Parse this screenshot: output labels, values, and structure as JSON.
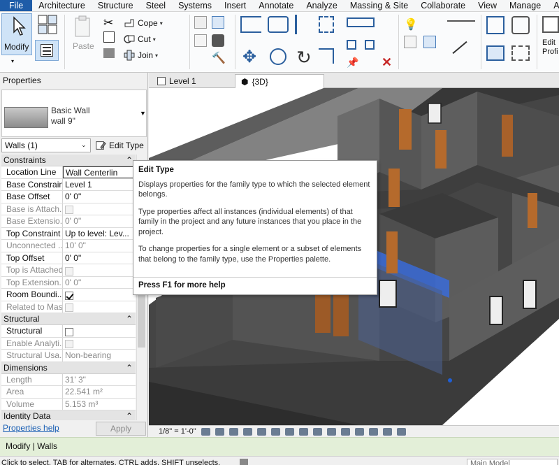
{
  "menu_tabs": [
    "File",
    "Architecture",
    "Structure",
    "Steel",
    "Systems",
    "Insert",
    "Annotate",
    "Analyze",
    "Massing & Site",
    "Collaborate",
    "View",
    "Manage",
    "Add-Ins"
  ],
  "ribbon": {
    "modify": "Modify",
    "paste": "Paste",
    "cope": "Cope",
    "cut": "Cut",
    "join": "Join",
    "edit_profile": "Edit\nProfi"
  },
  "properties": {
    "title": "Properties",
    "type_family": "Basic Wall",
    "type_name": "wall 9\"",
    "filter": "Walls (1)",
    "edit_type": "Edit Type",
    "sections": {
      "constraints": "Constraints",
      "structural": "Structural",
      "dimensions": "Dimensions",
      "identity": "Identity Data"
    },
    "constraints": [
      {
        "name": "Location Line",
        "value": "Wall Centerlin"
      },
      {
        "name": "Base Constraint",
        "value": "Level 1"
      },
      {
        "name": "Base Offset",
        "value": "0'  0\""
      },
      {
        "name": "Base is Attach...",
        "value": ""
      },
      {
        "name": "Base Extensio...",
        "value": "0'  0\""
      },
      {
        "name": "Top Constraint",
        "value": "Up to level: Lev..."
      },
      {
        "name": "Unconnected ...",
        "value": "10'  0\""
      },
      {
        "name": "Top Offset",
        "value": "0'  0\""
      },
      {
        "name": "Top is Attached",
        "value": ""
      },
      {
        "name": "Top Extension...",
        "value": "0'  0\""
      },
      {
        "name": "Room Boundi...",
        "value": ""
      },
      {
        "name": "Related to Mass",
        "value": ""
      }
    ],
    "structural": [
      {
        "name": "Structural",
        "value": ""
      },
      {
        "name": "Enable Analyti...",
        "value": ""
      },
      {
        "name": "Structural Usa...",
        "value": "Non-bearing"
      }
    ],
    "dimensions": [
      {
        "name": "Length",
        "value": "31'  3\""
      },
      {
        "name": "Area",
        "value": "22.541 m²"
      },
      {
        "name": "Volume",
        "value": "5.153 m³"
      }
    ],
    "help_link": "Properties help",
    "apply": "Apply"
  },
  "view_tabs": {
    "level1": "Level 1",
    "view3d": "{3D}"
  },
  "tooltip": {
    "title": "Edit Type",
    "p1": "Displays properties for the family type to which the selected element belongs.",
    "p2": "Type properties affect all instances (individual elements) of that family in the project and any future instances that you place in the project.",
    "p3": "To change properties for a single element or a subset of elements that belong to the family type, use the Properties palette.",
    "help": "Press F1 for more help"
  },
  "view_scale": "1/8\" = 1'-0\"",
  "status": {
    "context": "Modify | Walls",
    "hint": "Click to select, TAB for alternates, CTRL adds, SHIFT unselects.",
    "model": "Main Model"
  },
  "colors": {
    "file_tab": "#1e5ca8",
    "selection_blue": "#3a6bd8",
    "status_green": "#e3efd8",
    "link": "#1a5fb4"
  }
}
